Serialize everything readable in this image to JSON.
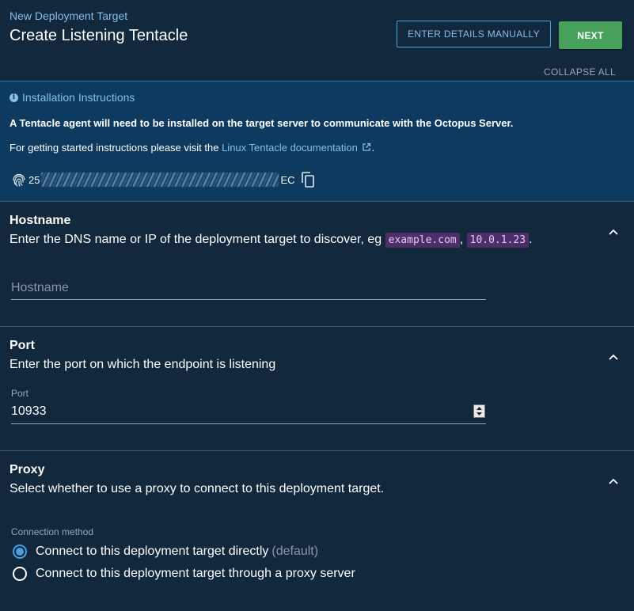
{
  "header": {
    "breadcrumb": "New Deployment Target",
    "title": "Create Listening Tentacle",
    "enter_details_label": "ENTER DETAILS MANUALLY",
    "next_label": "NEXT",
    "collapse_all_label": "COLLAPSE ALL"
  },
  "installation": {
    "title": "Installation Instructions",
    "bold_text": "A Tentacle agent will need to be installed on the target server to communicate with the Octopus Server.",
    "instructions_prefix": "For getting started instructions please visit the ",
    "link_text": "Linux Tentacle documentation",
    "instructions_suffix": ".",
    "thumbprint_start": "25",
    "thumbprint_end": "EC"
  },
  "hostname": {
    "title": "Hostname",
    "description_prefix": "Enter the DNS name or IP of the deployment target to discover, eg ",
    "example_1": "example.com",
    "separator": ", ",
    "example_2": "10.0.1.23",
    "description_suffix": ".",
    "placeholder": "Hostname"
  },
  "port": {
    "title": "Port",
    "description": "Enter the port on which the endpoint is listening",
    "field_label": "Port",
    "value": "10933"
  },
  "proxy": {
    "title": "Proxy",
    "description": "Select whether to use a proxy to connect to this deployment target.",
    "connection_label": "Connection method",
    "options": [
      {
        "label": "Connect to this deployment target directly",
        "suffix": "(default)",
        "selected": true
      },
      {
        "label": "Connect to this deployment target through a proxy server",
        "selected": false
      }
    ]
  },
  "colors": {
    "background": "#11283d",
    "install_background": "#0d3a5e",
    "accent": "#4a9fe0",
    "next_button": "#48a15a",
    "code_background": "#4d2e66"
  }
}
